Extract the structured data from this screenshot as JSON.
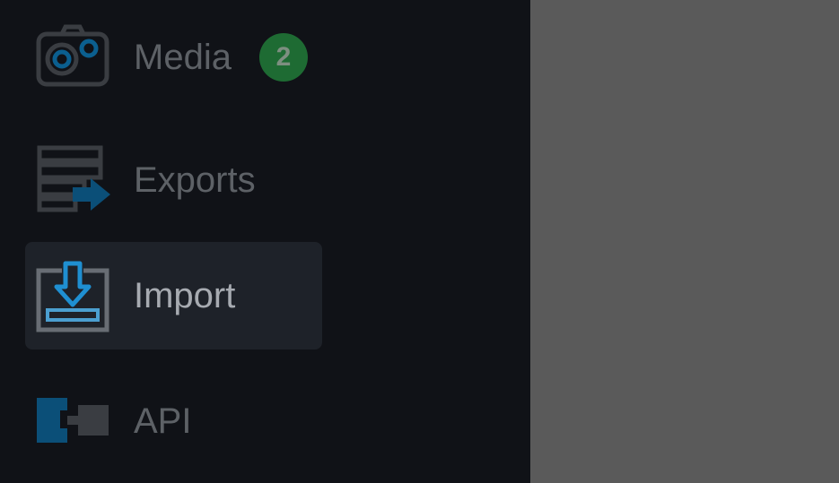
{
  "sidebar": {
    "items": [
      {
        "label": "Media",
        "icon": "camera-icon",
        "badge": "2",
        "active": false
      },
      {
        "label": "Exports",
        "icon": "export-icon",
        "active": false
      },
      {
        "label": "Import",
        "icon": "import-icon",
        "active": true
      },
      {
        "label": "API",
        "icon": "api-icon",
        "active": false
      }
    ]
  },
  "colors": {
    "sidebar_bg": "#101217",
    "active_bg": "#1e2229",
    "badge_bg": "#1e6b33",
    "accent_blue": "#0b5f8f",
    "overlay": "#5a5a5a"
  }
}
